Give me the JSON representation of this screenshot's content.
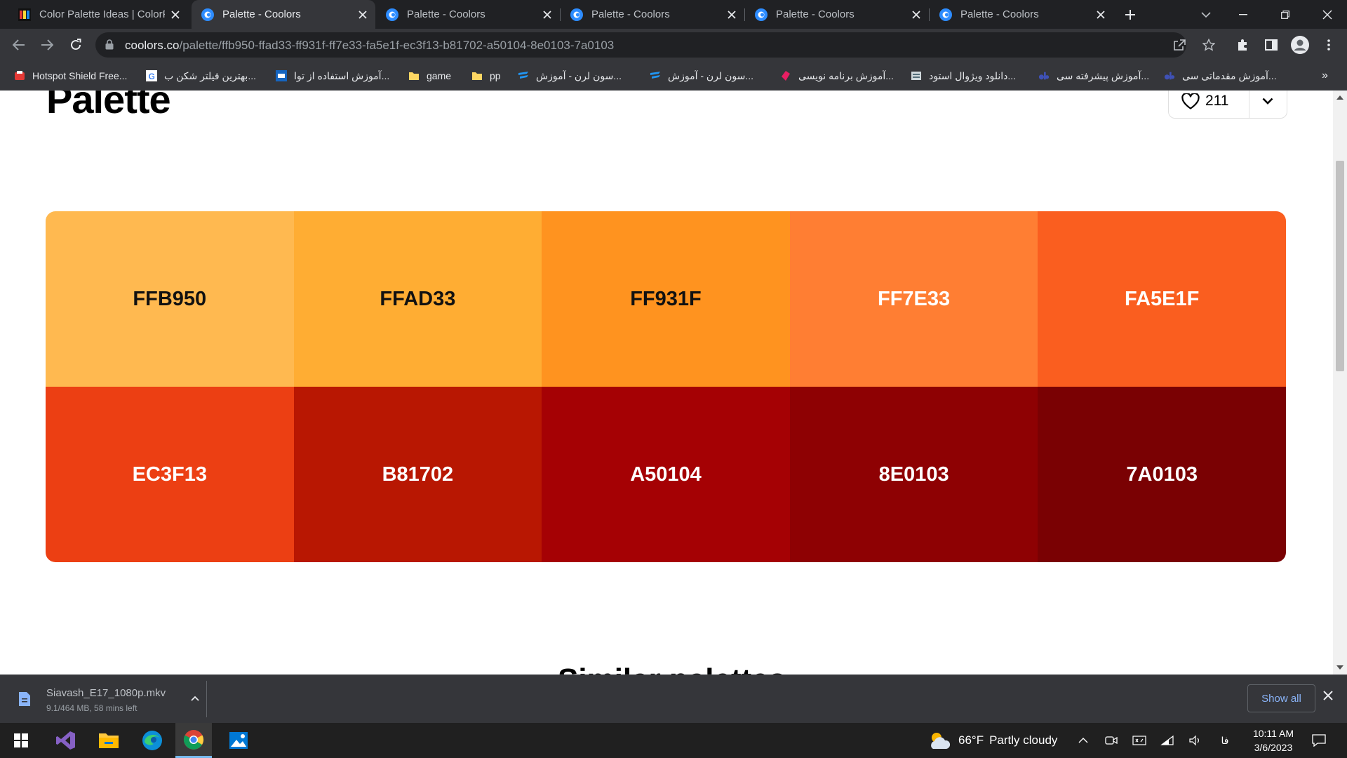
{
  "browser": {
    "tabs": [
      {
        "title": "Color Palette Ideas | ColorP",
        "active": false
      },
      {
        "title": "Palette - Coolors",
        "active": true
      },
      {
        "title": "Palette - Coolors",
        "active": false
      },
      {
        "title": "Palette - Coolors",
        "active": false
      },
      {
        "title": "Palette - Coolors",
        "active": false
      },
      {
        "title": "Palette - Coolors",
        "active": false
      }
    ],
    "url_host": "coolors.co",
    "url_path": "/palette/ffb950-ffad33-ff931f-ff7e33-fa5e1f-ec3f13-b81702-a50104-8e0103-7a0103",
    "bookmarks": [
      {
        "label": "Hotspot Shield Free..."
      },
      {
        "label": "بهترین فیلتر شکن ب..."
      },
      {
        "label": "آموزش استفاده از توا..."
      },
      {
        "label": "game"
      },
      {
        "label": "pp"
      },
      {
        "label": "سون لرن - آموزش..."
      },
      {
        "label": "سون لرن - آموزش..."
      },
      {
        "label": "آموزش برنامه نویسی..."
      },
      {
        "label": "دانلود ویژوال استود..."
      },
      {
        "label": "آموزش پیشرفته سی..."
      },
      {
        "label": "آموزش مقدماتی سی..."
      }
    ],
    "bookmarks_more": "»"
  },
  "page": {
    "title": "Palette",
    "likes": "211",
    "swatches": [
      {
        "hex": "FFB950",
        "color": "#FFB950",
        "text_tone": "dark"
      },
      {
        "hex": "FFAD33",
        "color": "#FFAD33",
        "text_tone": "dark"
      },
      {
        "hex": "FF931F",
        "color": "#FF931F",
        "text_tone": "dark"
      },
      {
        "hex": "FF7E33",
        "color": "#FF7E33",
        "text_tone": "light"
      },
      {
        "hex": "FA5E1F",
        "color": "#FA5E1F",
        "text_tone": "light"
      },
      {
        "hex": "EC3F13",
        "color": "#EC3F13",
        "text_tone": "light"
      },
      {
        "hex": "B81702",
        "color": "#B81702",
        "text_tone": "light"
      },
      {
        "hex": "A50104",
        "color": "#A50104",
        "text_tone": "light"
      },
      {
        "hex": "8E0103",
        "color": "#8E0103",
        "text_tone": "light"
      },
      {
        "hex": "7A0103",
        "color": "#7A0103",
        "text_tone": "light"
      }
    ],
    "next_heading_partial": "Similar palettes"
  },
  "downloads": {
    "file_name": "Siavash_E17_1080p.mkv",
    "status": "9.1/464 MB, 58 mins left",
    "show_all": "Show all"
  },
  "taskbar": {
    "weather_temp": "66°F",
    "weather_text": "Partly cloudy",
    "language": "فا",
    "time": "10:11 AM",
    "date": "3/6/2023"
  }
}
